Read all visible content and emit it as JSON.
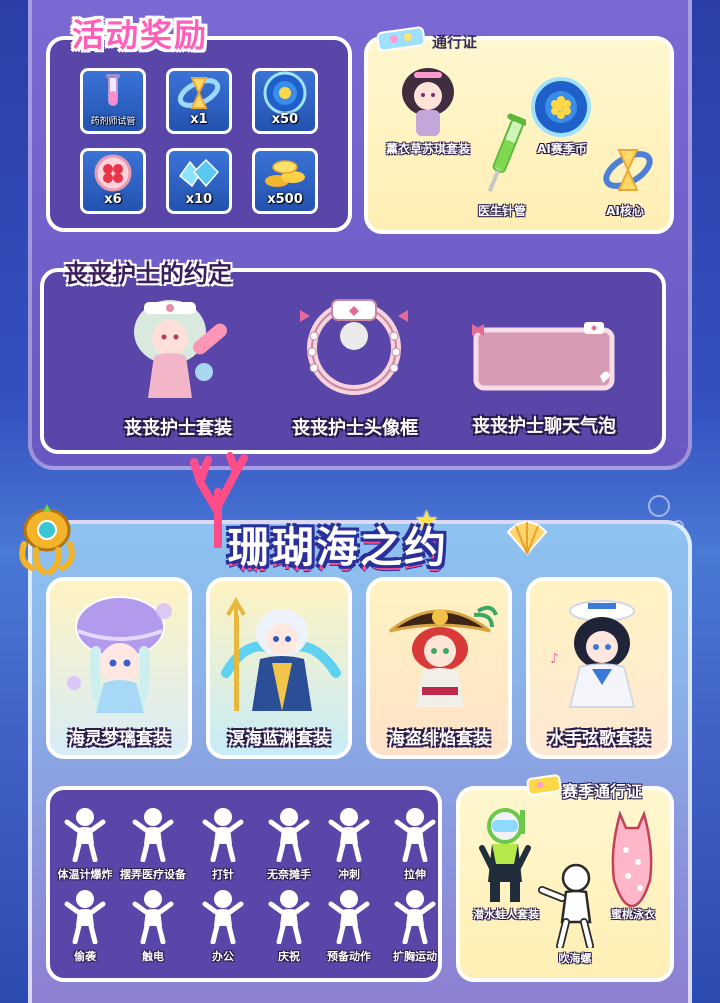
{
  "rewards": {
    "title": "活动奖励",
    "items": [
      {
        "icon": "potion-tube-icon",
        "qty": "药剂师试管"
      },
      {
        "icon": "hourglass-ring-icon",
        "qty": "x1"
      },
      {
        "icon": "season-coin-icon",
        "qty": "x50"
      },
      {
        "icon": "clover-orb-icon",
        "qty": "x6"
      },
      {
        "icon": "blue-gem-cluster-icon",
        "qty": "x10"
      },
      {
        "icon": "gold-coins-icon",
        "qty": "x500"
      }
    ]
  },
  "pass": {
    "title": "通行证",
    "items": [
      {
        "icon": "lavender-suit-icon",
        "label": "薰衣草苏琪套装"
      },
      {
        "icon": "season-coin-icon",
        "label": "AI赛季币"
      },
      {
        "icon": "syringe-icon",
        "label": "医生针管"
      },
      {
        "icon": "ai-core-icon",
        "label": "AI核心"
      }
    ]
  },
  "nurse": {
    "title": "丧丧护士的约定",
    "items": [
      {
        "icon": "nurse-suit-icon",
        "label": "丧丧护士套装"
      },
      {
        "icon": "nurse-avatar-frame-icon",
        "label": "丧丧护士头像框"
      },
      {
        "icon": "nurse-chat-bubble-icon",
        "label": "丧丧护士聊天气泡"
      }
    ]
  },
  "coral": {
    "title": "珊瑚海之约",
    "costumes": [
      {
        "icon": "jellyfish-suit-icon",
        "label": "海灵梦璃套装",
        "bg": "#bfe3f7"
      },
      {
        "icon": "ocean-king-suit-icon",
        "label": "溟海蓝渊套装",
        "bg": "#c8ecf7"
      },
      {
        "icon": "pirate-suit-icon",
        "label": "海盗绯焰套装",
        "bg": "#ffe9c9"
      },
      {
        "icon": "sailor-suit-icon",
        "label": "水手弦歌套装",
        "bg": "#ffe6cf"
      }
    ]
  },
  "emotes": [
    {
      "icon": "thermometer-explode-icon",
      "label": "体温计爆炸"
    },
    {
      "icon": "medical-device-icon",
      "label": "摆弄医疗设备"
    },
    {
      "icon": "injection-icon",
      "label": "打针"
    },
    {
      "icon": "shrug-icon",
      "label": "无奈摊手"
    },
    {
      "icon": "sprint-icon",
      "label": "冲刺"
    },
    {
      "icon": "stretch-icon",
      "label": "拉伸"
    },
    {
      "icon": "sneak-attack-icon",
      "label": "偷袭"
    },
    {
      "icon": "electric-shock-icon",
      "label": "触电"
    },
    {
      "icon": "office-icon",
      "label": "办公"
    },
    {
      "icon": "celebrate-icon",
      "label": "庆祝"
    },
    {
      "icon": "ready-pose-icon",
      "label": "预备动作"
    },
    {
      "icon": "chest-exercise-icon",
      "label": "扩胸运动"
    }
  ],
  "season_pass": {
    "title": "赛季通行证",
    "items": [
      {
        "icon": "diver-suit-icon",
        "label": "潜水蛙人套装"
      },
      {
        "icon": "conch-blow-icon",
        "label": "吹海螺"
      },
      {
        "icon": "peach-swimsuit-icon",
        "label": "蜜桃泳衣"
      }
    ]
  },
  "colors": {
    "title_pink": "#ff5fb8",
    "panel_dark": "#5a46a8",
    "panel_light": "#fff3c2",
    "tile_blue": "#2f63c4"
  }
}
